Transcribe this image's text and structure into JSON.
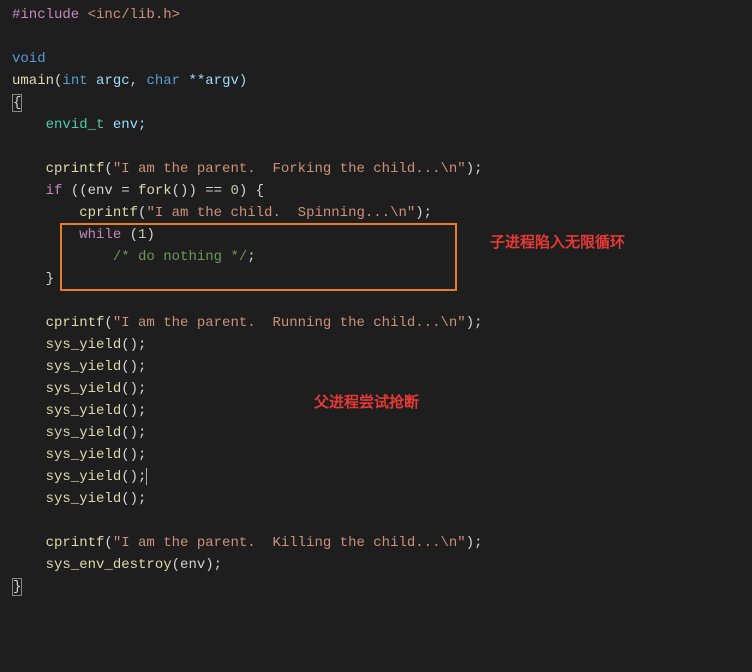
{
  "lines": {
    "l1_pp": "#include",
    "l1_inc": " <inc/lib.h>",
    "l3_void": "void",
    "l4_fn": "umain",
    "l4_sig1": "(",
    "l4_int": "int",
    "l4_argc": " argc, ",
    "l4_char": "char",
    "l4_argv": " **argv)",
    "l5": "{",
    "l6_ind": "    ",
    "l6_type": "envid_t",
    "l6_var": " env;",
    "l8_ind": "    ",
    "l8_fn": "cprintf",
    "l8_p1": "(",
    "l8_str": "\"I am the parent.  Forking the child...\\n\"",
    "l8_p2": ");",
    "l9_ind": "    ",
    "l9_if": "if",
    "l9_p1": " ((env = ",
    "l9_fork": "fork",
    "l9_p2": "()) == ",
    "l9_zero": "0",
    "l9_p3": ") {",
    "l10_ind": "        ",
    "l10_fn": "cprintf",
    "l10_p1": "(",
    "l10_str": "\"I am the child.  Spinning...\\n\"",
    "l10_p2": ");",
    "l11_ind": "        ",
    "l11_while": "while",
    "l11_p1": " (",
    "l11_one": "1",
    "l11_p2": ")",
    "l12_ind": "            ",
    "l12_cmt": "/* do nothing */",
    "l12_semi": ";",
    "l13_ind": "    ",
    "l13": "}",
    "l15_ind": "    ",
    "l15_fn": "cprintf",
    "l15_p1": "(",
    "l15_str": "\"I am the parent.  Running the child...\\n\"",
    "l15_p2": ");",
    "l16_ind": "    ",
    "l16_fn": "sys_yield",
    "l16_p": "();",
    "l17_ind": "    ",
    "l17_fn": "sys_yield",
    "l17_p": "();",
    "l18_ind": "    ",
    "l18_fn": "sys_yield",
    "l18_p": "();",
    "l19_ind": "    ",
    "l19_fn": "sys_yield",
    "l19_p": "();",
    "l20_ind": "    ",
    "l20_fn": "sys_yield",
    "l20_p": "();",
    "l21_ind": "    ",
    "l21_fn": "sys_yield",
    "l21_p": "();",
    "l22_ind": "    ",
    "l22_fn": "sys_yield",
    "l22_p": "();",
    "l23_ind": "    ",
    "l23_fn": "sys_yield",
    "l23_p": "();",
    "l25_ind": "    ",
    "l25_fn": "cprintf",
    "l25_p1": "(",
    "l25_str": "\"I am the parent.  Killing the child...\\n\"",
    "l25_p2": ");",
    "l26_ind": "    ",
    "l26_fn": "sys_env_destroy",
    "l26_p1": "(env);",
    "l27": "}"
  },
  "annotations": {
    "child": "子进程陷入无限循环",
    "parent": "父进程尝试抢断"
  }
}
